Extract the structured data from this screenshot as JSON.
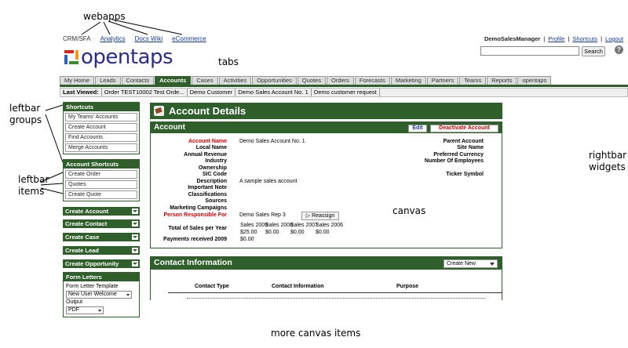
{
  "annotations": {
    "webapps": "webapps",
    "tabs": "tabs",
    "leftbar_groups": [
      "leftbar",
      "groups"
    ],
    "leftbar_items": [
      "leftbar",
      "items"
    ],
    "rightbar_widgets": [
      "rightbar",
      "widgets"
    ],
    "canvas": "canvas",
    "more_canvas": "more canvas items"
  },
  "webapps": [
    "CRM/SFA",
    "Analytics",
    "Docs Wiki",
    "eCommerce"
  ],
  "logo_text": "opentaps",
  "userbar": {
    "user": "DemoSalesManager",
    "links": [
      "Profile",
      "Shortcuts",
      "Logout"
    ]
  },
  "search": {
    "button": "Search",
    "value": ""
  },
  "tabs": [
    "My Home",
    "Leads",
    "Contacts",
    "Accounts",
    "Cases",
    "Activities",
    "Opportunities",
    "Quotes",
    "Orders",
    "Forecasts",
    "Marketing",
    "Partners",
    "Teams",
    "Reports",
    "opentaps"
  ],
  "active_tab": "Accounts",
  "last_viewed": {
    "label": "Last Viewed:",
    "items": [
      "Order TEST10002 Test Orde...",
      "Demo Customer",
      "Demo Sales Account No. 1",
      "Demo customer request"
    ]
  },
  "leftbar": {
    "shortcuts": {
      "title": "Shortcuts",
      "items": [
        "My Teams' Accounts",
        "Create Account",
        "Find Accounts",
        "Merge Accounts"
      ]
    },
    "account_shortcuts": {
      "title": "Account Shortcuts",
      "items": [
        "Create Order",
        "Quotes",
        "Create Quote"
      ]
    },
    "collapsed": [
      "Create Account",
      "Create Contact",
      "Create Case",
      "Create Lead",
      "Create Opportunity"
    ],
    "form_letters": {
      "title": "Form Letters",
      "template_label": "Form Letter Template",
      "template_value": "New User Welcome",
      "output_label": "Output",
      "output_value": "PDF"
    }
  },
  "page_title": "Account Details",
  "account": {
    "header": "Account",
    "edit": "Edit",
    "deactivate": "Deactivate Account",
    "left_labels": [
      "Account Name",
      "Local Name",
      "Annual Revenue",
      "Industry",
      "Ownership",
      "SIC Code",
      "Description",
      "Important Note",
      "Classifications",
      "Sources",
      "Marketing Campaigns",
      "Person Responsible For"
    ],
    "account_name": "Demo Sales Account No. 1",
    "description": "A sample sales account",
    "person_responsible": "Demo Sales Rep 3",
    "reassign": "Reassign",
    "right_labels": [
      "Parent Account",
      "Site Name",
      "Preferred Currency",
      "Number Of Employees",
      "Ticker Symbol"
    ],
    "total_sales_label": "Total of Sales per Year",
    "sales_years": [
      "Sales 2009",
      "Sales 2008",
      "Sales 2007",
      "Sales 2006"
    ],
    "sales_values": [
      "$25.00",
      "$0.00",
      "$0.00",
      "$0.00"
    ],
    "payments_label": "Payments received 2009",
    "payments_value": "$0.00"
  },
  "contact": {
    "header": "Contact Information",
    "create_new": "Create New",
    "columns": [
      "Contact Type",
      "Contact Information",
      "Purpose"
    ]
  },
  "colors": {
    "primary_green": "#2f5f2a",
    "link_blue": "#1a3a9a",
    "required_red": "#cc0000"
  }
}
